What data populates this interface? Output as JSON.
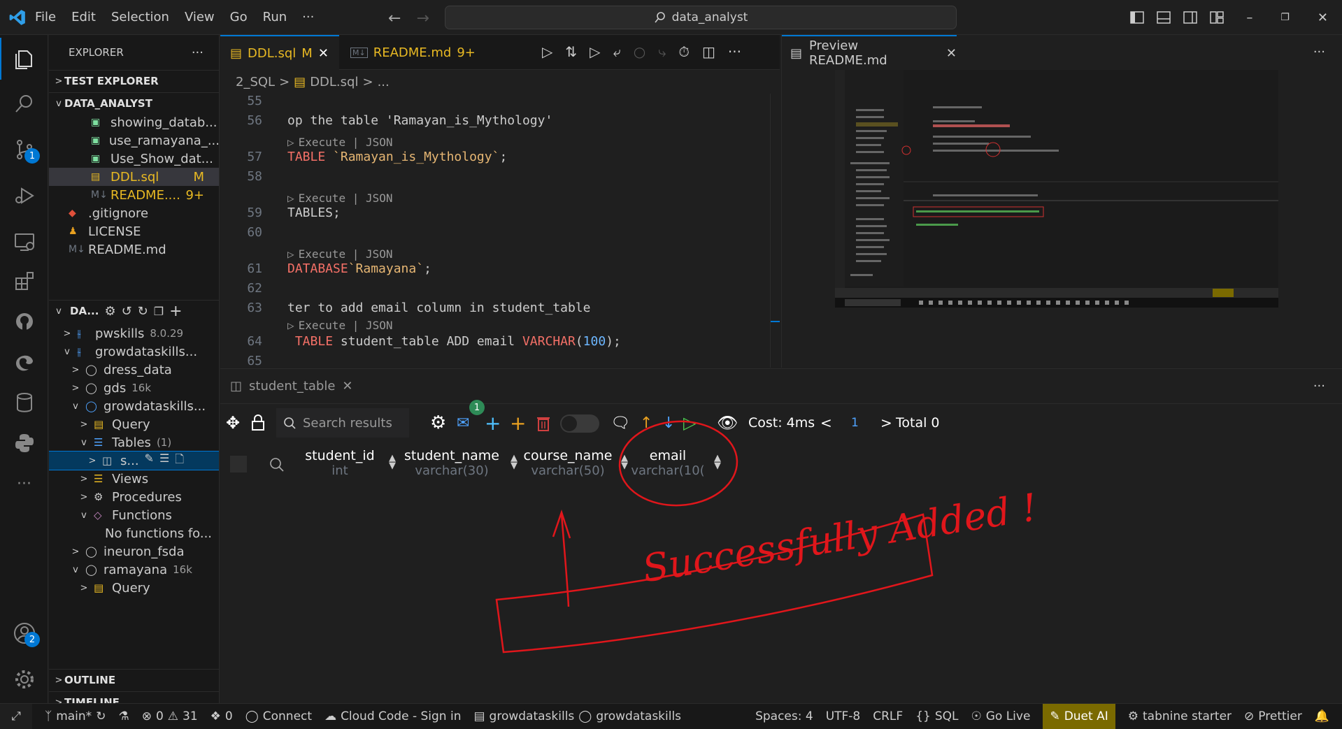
{
  "title_bar": {
    "menu": [
      "File",
      "Edit",
      "Selection",
      "View",
      "Go",
      "Run"
    ],
    "more": "···",
    "search": "data_analyst"
  },
  "explorer": {
    "title": "EXPLORER",
    "more": "···",
    "test_explorer": "TEST EXPLORER",
    "folder": "DATA_ANALYST",
    "files": [
      {
        "name": "showing_datab...",
        "badge": "",
        "icon": "image-icon"
      },
      {
        "name": "use_ramayana_...",
        "badge": "",
        "icon": "image-icon"
      },
      {
        "name": "Use_Show_dat...",
        "badge": "",
        "icon": "image-icon"
      },
      {
        "name": "DDL.sql",
        "badge": "M",
        "icon": "database-icon"
      },
      {
        "name": "README....",
        "badge": "9+",
        "icon": "markdown-icon"
      },
      {
        "name": ".gitignore",
        "badge": "",
        "icon": "git-icon"
      },
      {
        "name": "LICENSE",
        "badge": "",
        "icon": "license-icon"
      },
      {
        "name": "README.md",
        "badge": "",
        "icon": "markdown-icon"
      }
    ],
    "db_section": "DA...",
    "db_tree": [
      {
        "label": "pwskills",
        "meta": "8.0.29",
        "indent": 1,
        "chev": ">"
      },
      {
        "label": "growdataskills...",
        "meta": "",
        "indent": 1,
        "chev": "v"
      },
      {
        "label": "dress_data",
        "meta": "",
        "indent": 2,
        "chev": ">"
      },
      {
        "label": "gds",
        "meta": "16k",
        "indent": 2,
        "chev": ">"
      },
      {
        "label": "growdataskills...",
        "meta": "",
        "indent": 2,
        "chev": "v"
      },
      {
        "label": "Query",
        "meta": "",
        "indent": 3,
        "chev": ">"
      },
      {
        "label": "Tables",
        "meta": "(1)",
        "indent": 3,
        "chev": "v"
      },
      {
        "label": "s...",
        "meta": "",
        "indent": 4,
        "chev": ">"
      },
      {
        "label": "Views",
        "meta": "",
        "indent": 3,
        "chev": ">"
      },
      {
        "label": "Procedures",
        "meta": "",
        "indent": 3,
        "chev": ">"
      },
      {
        "label": "Functions",
        "meta": "",
        "indent": 3,
        "chev": "v"
      },
      {
        "label": "No functions fo...",
        "meta": "",
        "indent": 4,
        "chev": ""
      },
      {
        "label": "ineuron_fsda",
        "meta": "",
        "indent": 2,
        "chev": ">"
      },
      {
        "label": "ramayana",
        "meta": "16k",
        "indent": 2,
        "chev": "v"
      },
      {
        "label": "Query",
        "meta": "",
        "indent": 3,
        "chev": ">"
      }
    ],
    "outline": "OUTLINE",
    "timeline": "TIMELINE"
  },
  "activity": {
    "scm_badge": "1",
    "account_badge": "2",
    "more": "···"
  },
  "editor": {
    "tabs": [
      {
        "label": "DDL.sql",
        "badge": "M"
      },
      {
        "label": "README.md",
        "badge": "9+"
      }
    ],
    "breadcrumb": [
      "2_SQL",
      "DDL.sql",
      "..."
    ],
    "lines": [
      {
        "n": "55",
        "html": ""
      },
      {
        "n": "56",
        "html": "op the table 'Ramayan_is_Mythology'"
      },
      {
        "n": "57",
        "html": "<span class=\"kw\">TABLE</span> <span class=\"str\">`Ramayan_is_Mythology`</span>;"
      },
      {
        "n": "58",
        "html": ""
      },
      {
        "n": "59",
        "html": "TABLES;"
      },
      {
        "n": "60",
        "html": ""
      },
      {
        "n": "61",
        "html": "<span class=\"kw\">DATABASE</span><span class=\"str\">`Ramayana`</span>;"
      },
      {
        "n": "62",
        "html": ""
      },
      {
        "n": "63",
        "html": "ter to add email column in student_table"
      },
      {
        "n": "64",
        "html": " <span class=\"kw\">TABLE</span> student_table ADD email <span class=\"kw\">VARCHAR</span>(<span class=\"num\">100</span>);"
      },
      {
        "n": "65",
        "html": ""
      }
    ],
    "codelens": "Execute | JSON"
  },
  "preview": {
    "tab": "Preview README.md",
    "more": "···"
  },
  "panel": {
    "tab": "student_table",
    "more": "···",
    "search_placeholder": "Search results",
    "mail_badge": "1",
    "cost": "Cost: 4ms",
    "page": "1",
    "total": "Total 0",
    "columns": [
      {
        "name": "student_id",
        "type": "int"
      },
      {
        "name": "student_name",
        "type": "varchar(30)"
      },
      {
        "name": "course_name",
        "type": "varchar(50)"
      },
      {
        "name": "email",
        "type": "varchar(10("
      }
    ],
    "annotation": "Successfully Added !"
  },
  "status": {
    "branch": "main*",
    "errors": "0",
    "warnings": "31",
    "ports": "0",
    "connect": "Connect",
    "cloud": "Cloud Code - Sign in",
    "db1": "growdataskills",
    "db2": "growdataskills",
    "spaces": "Spaces: 4",
    "encoding": "UTF-8",
    "eol": "CRLF",
    "lang": "SQL",
    "golive": "Go Live",
    "duet": "Duet AI",
    "tabnine": "tabnine starter",
    "prettier": "Prettier"
  },
  "colors": {
    "accent": "#0078d4",
    "annotation": "#e0161b",
    "duet_bg": "#7a6a00"
  }
}
